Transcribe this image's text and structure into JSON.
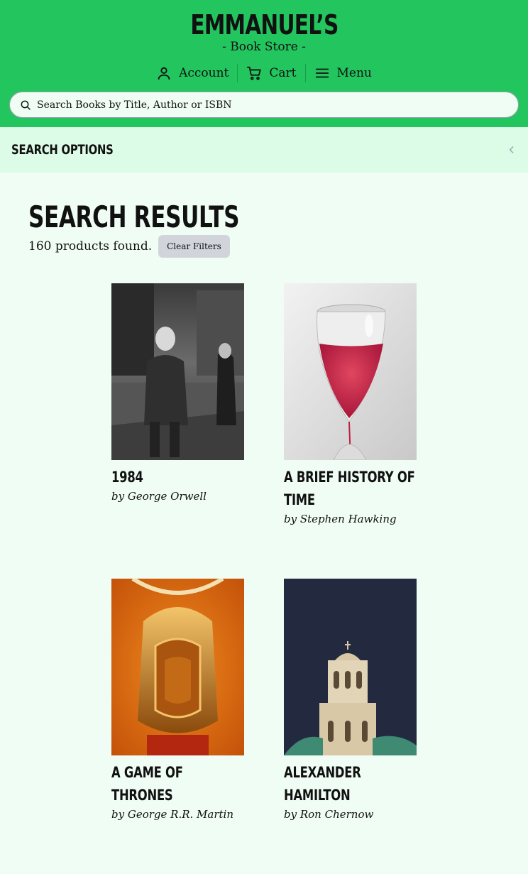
{
  "brand": {
    "title": "EMMANUEL’S",
    "subtitle": "- Book Store -"
  },
  "nav": {
    "account": "Account",
    "cart": "Cart",
    "menu": "Menu"
  },
  "search": {
    "placeholder": "Search Books by Title, Author or ISBN",
    "value": ""
  },
  "options": {
    "title": "SEARCH OPTIONS"
  },
  "results": {
    "title": "SEARCH RESULTS",
    "count": "160 products found.",
    "clear_label": "Clear Filters"
  },
  "books": [
    {
      "title": "1984",
      "author": "by George Orwell"
    },
    {
      "title": "A BRIEF HISTORY OF TIME",
      "author": "by Stephen Hawking"
    },
    {
      "title": "A GAME OF THRONES",
      "author": "by George R.R. Martin"
    },
    {
      "title": "ALEXANDER HAMILTON",
      "author": "by Ron Chernow"
    }
  ],
  "icons": {
    "account": "user-icon",
    "cart": "cart-icon",
    "menu": "hamburger-icon",
    "search": "search-icon",
    "collapse": "chevron-left-icon"
  },
  "colors": {
    "header": "#22c55e",
    "options_bar": "#dcfce7",
    "page": "#f0fdf4"
  }
}
